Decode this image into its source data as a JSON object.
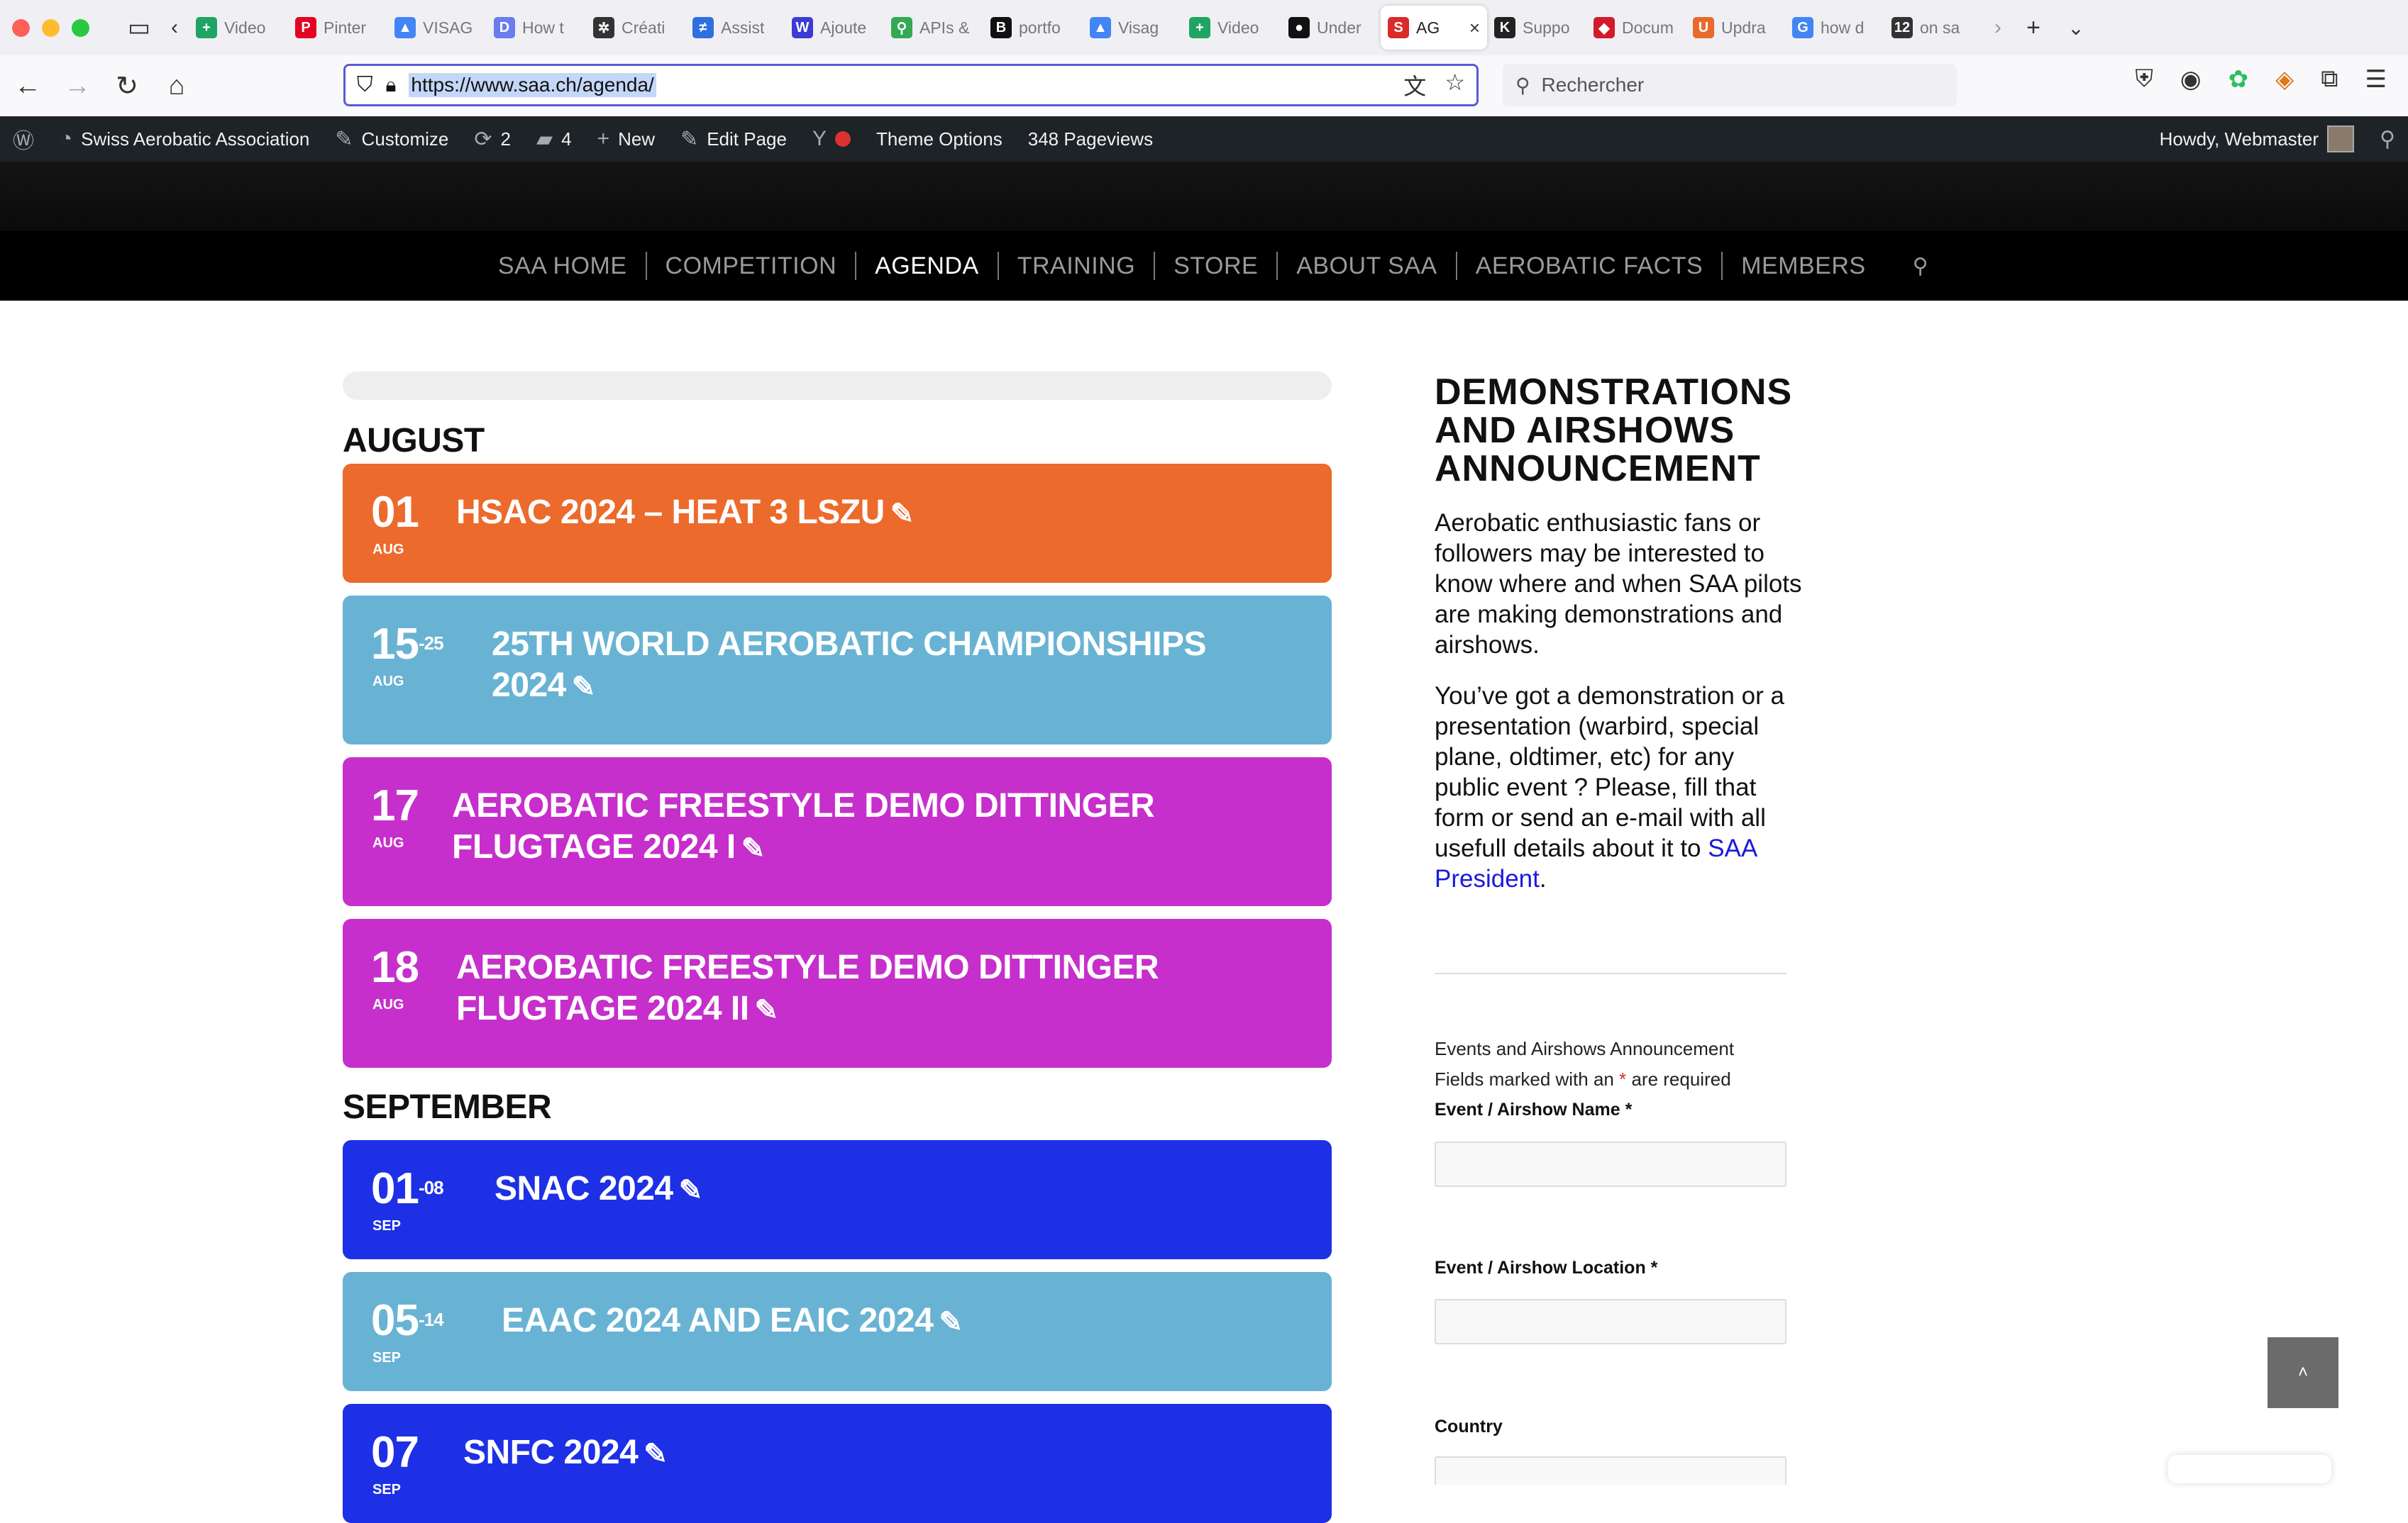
{
  "browser": {
    "tabs": [
      {
        "label": "Video",
        "fav_color": "#1fa463",
        "fav_glyph": "+"
      },
      {
        "label": "Pinter",
        "fav_color": "#e60023",
        "fav_glyph": "P"
      },
      {
        "label": "VISAG",
        "fav_color": "#4285f4",
        "fav_glyph": "▲"
      },
      {
        "label": "How t",
        "fav_color": "#6a7cf0",
        "fav_glyph": "D"
      },
      {
        "label": "Créati",
        "fav_color": "#333333",
        "fav_glyph": "✲"
      },
      {
        "label": "Assist",
        "fav_color": "#2f6fe0",
        "fav_glyph": "≠"
      },
      {
        "label": "Ajoute",
        "fav_color": "#3b3bd6",
        "fav_glyph": "W"
      },
      {
        "label": "APIs &",
        "fav_color": "#34a853",
        "fav_glyph": "⚲"
      },
      {
        "label": "portfo",
        "fav_color": "#111111",
        "fav_glyph": "B"
      },
      {
        "label": "Visag",
        "fav_color": "#4285f4",
        "fav_glyph": "▲"
      },
      {
        "label": "Video",
        "fav_color": "#1fa463",
        "fav_glyph": "+"
      },
      {
        "label": "Under",
        "fav_color": "#111111",
        "fav_glyph": "●"
      },
      {
        "label": "AG",
        "fav_color": "#d92b2b",
        "fav_glyph": "S"
      },
      {
        "label": "Suppo",
        "fav_color": "#222222",
        "fav_glyph": "K"
      },
      {
        "label": "Docum",
        "fav_color": "#d11a2a",
        "fav_glyph": "◆"
      },
      {
        "label": "Updra",
        "fav_color": "#e86a2d",
        "fav_glyph": "U"
      },
      {
        "label": "how d",
        "fav_color": "#4285f4",
        "fav_glyph": "G"
      },
      {
        "label": "on sa",
        "fav_color": "#333333",
        "fav_glyph": "12"
      }
    ],
    "active_tab_index": 12,
    "url": "https://www.saa.ch/agenda/",
    "search_placeholder": "Rechercher"
  },
  "adminbar": {
    "site_name": "Swiss Aerobatic Association",
    "customize": "Customize",
    "updates_count": "2",
    "comments_count": "4",
    "new_label": "New",
    "edit_page": "Edit Page",
    "theme_options": "Theme Options",
    "pageviews": "348 Pageviews",
    "howdy": "Howdy, Webmaster"
  },
  "menu": {
    "items": [
      "SAA HOME",
      "COMPETITION",
      "AGENDA",
      "TRAINING",
      "STORE",
      "ABOUT SAA",
      "AEROBATIC FACTS",
      "MEMBERS"
    ],
    "current_index": 2
  },
  "agenda": {
    "months": [
      {
        "label": "AUGUST"
      },
      {
        "label": "SEPTEMBER"
      }
    ],
    "events": [
      {
        "day": "01",
        "sup": "",
        "month": "AUG",
        "title": "HSAC 2024 – HEAT 3 LSZU",
        "color": "#ec6a2c"
      },
      {
        "day": "15",
        "sup": "-25",
        "month": "AUG",
        "title": "25TH WORLD AEROBATIC CHAMPIONSHIPS 2024",
        "color": "#68b3d4"
      },
      {
        "day": "17",
        "sup": "",
        "month": "AUG",
        "title": "AEROBATIC FREESTYLE DEMO DITTINGER FLUGTAGE 2024 I",
        "color": "#c62fcb"
      },
      {
        "day": "18",
        "sup": "",
        "month": "AUG",
        "title": "AEROBATIC FREESTYLE DEMO DITTINGER FLUGTAGE 2024 II",
        "color": "#c62fcb"
      },
      {
        "day": "01",
        "sup": "-08",
        "month": "SEP",
        "title": "SNAC 2024",
        "color": "#1d30e6"
      },
      {
        "day": "05",
        "sup": "-14",
        "month": "SEP",
        "title": "EAAC 2024 AND EAIC 2024",
        "color": "#68b3d4"
      },
      {
        "day": "07",
        "sup": "",
        "month": "SEP",
        "title": "SNFC 2024",
        "color": "#1d30e6"
      }
    ]
  },
  "sidebar": {
    "title": "DEMONSTRATIONS AND AIRSHOWS ANNOUNCEMENT",
    "para1": "Aerobatic enthusiastic fans or followers may be interested to know where and when SAA pilots are making demonstrations and airshows.",
    "para2_text": "You’ve got a demonstration or a presentation (warbird, special plane, oldtimer, etc)  for any public event ? Please, fill that form or send an e-mail with all usefull details about it to ",
    "para2_link": "SAA President",
    "para2_end": ".",
    "form_title": "Events and Airshows Announcement",
    "required_prefix": "Fields marked with an ",
    "required_star": "*",
    "required_suffix": " are required",
    "field1_label": "Event / Airshow Name",
    "field2_label": "Event / Airshow Location",
    "field3_label": "Country",
    "star": "*"
  }
}
